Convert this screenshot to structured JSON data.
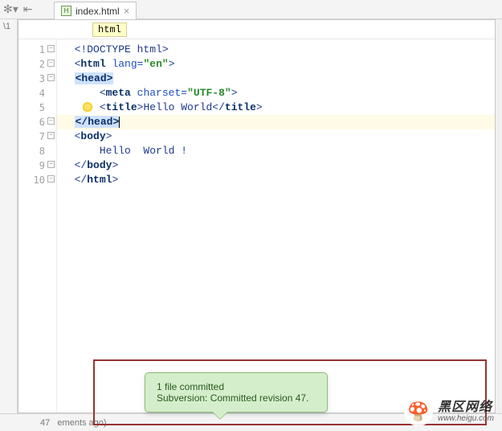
{
  "left_col": {
    "text": "\\1"
  },
  "tab": {
    "filename": "index.html",
    "close": "×"
  },
  "breadcrumb": {
    "label": "html"
  },
  "gutter": [
    "1",
    "2",
    "3",
    "4",
    "5",
    "6",
    "7",
    "8",
    "9",
    "10"
  ],
  "code": {
    "l1_declpre": "<!",
    "l1_decl": "DOCTYPE html",
    "l1_declpost": ">",
    "l2_open": "<",
    "l2_tag": "html",
    "l2_sp": " ",
    "l2_attr": "lang=",
    "l2_q1": "\"",
    "l2_val": "en",
    "l2_q2": "\"",
    "l2_close": ">",
    "l3_open": "<",
    "l3_tag": "head",
    "l3_close": ">",
    "l4_open": "<",
    "l4_tag": "meta",
    "l4_sp": " ",
    "l4_attr": "charset=",
    "l4_q1": "\"",
    "l4_val": "UTF-8",
    "l4_q2": "\"",
    "l4_close": ">",
    "l5_open": "<",
    "l5_tag": "title",
    "l5_close": ">",
    "l5_text": "Hello World",
    "l5_open2": "</",
    "l5_tag2": "title",
    "l5_close2": ">",
    "l6_open": "</",
    "l6_tag": "head",
    "l6_close": ">",
    "l7_open": "<",
    "l7_tag": "body",
    "l7_close": ">",
    "l8_text": "Hello  World !",
    "l9_open": "</",
    "l9_tag": "body",
    "l9_close": ">",
    "l10_open": "</",
    "l10_tag": "html",
    "l10_close": ">"
  },
  "popup": {
    "line1": "1 file committed",
    "line2": "Subversion: Committed revision 47."
  },
  "bottom": {
    "hint": "ements ago)",
    "hint_pre": "47"
  },
  "watermark": {
    "cn": "黑区网络",
    "en": "www.heigu.com",
    "logo": "🍄"
  }
}
